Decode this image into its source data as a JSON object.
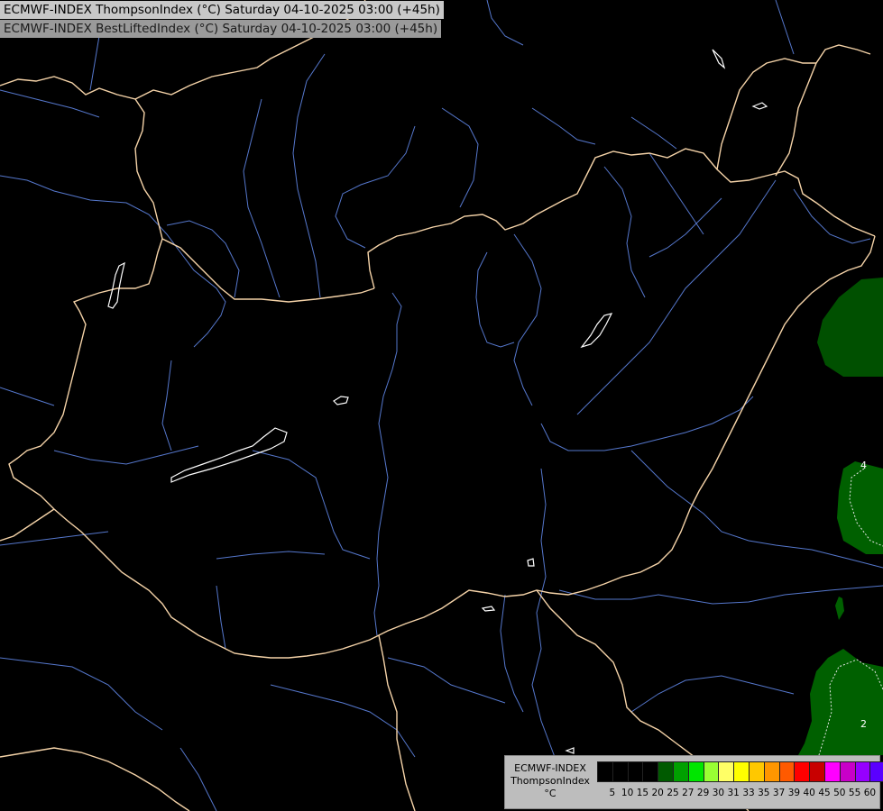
{
  "header": {
    "line1": "ECMWF-INDEX ThompsonIndex (°C) Saturday 04-10-2025 03:00 (+45h)",
    "line2": "ECMWF-INDEX BestLiftedIndex (°C) Saturday 04-10-2025 03:00 (+45h)"
  },
  "map": {
    "background_color": "#000000",
    "border_color": "#f5d3a8",
    "river_color": "#5577cc",
    "lake_color": "#ffffff",
    "contour_labels": [
      "4",
      "2"
    ],
    "shaded_field_color": "#005000"
  },
  "legend": {
    "title_line1": "ECMWF-INDEX",
    "title_line2": "ThompsonIndex",
    "unit": "°C",
    "ticks": [
      "5",
      "10",
      "15",
      "20",
      "25",
      "27",
      "29",
      "30",
      "31",
      "33",
      "35",
      "37",
      "39",
      "40",
      "45",
      "50",
      "55",
      "60"
    ],
    "colors": [
      "#000000",
      "#000000",
      "#000000",
      "#000000",
      "#005a00",
      "#00a000",
      "#00e600",
      "#99ff33",
      "#ffff66",
      "#ffff00",
      "#ffc800",
      "#ff9600",
      "#ff5a00",
      "#ff0000",
      "#c80000",
      "#ff00ff",
      "#c800c8",
      "#9600ff",
      "#5a00ff",
      "#0000ff"
    ]
  }
}
